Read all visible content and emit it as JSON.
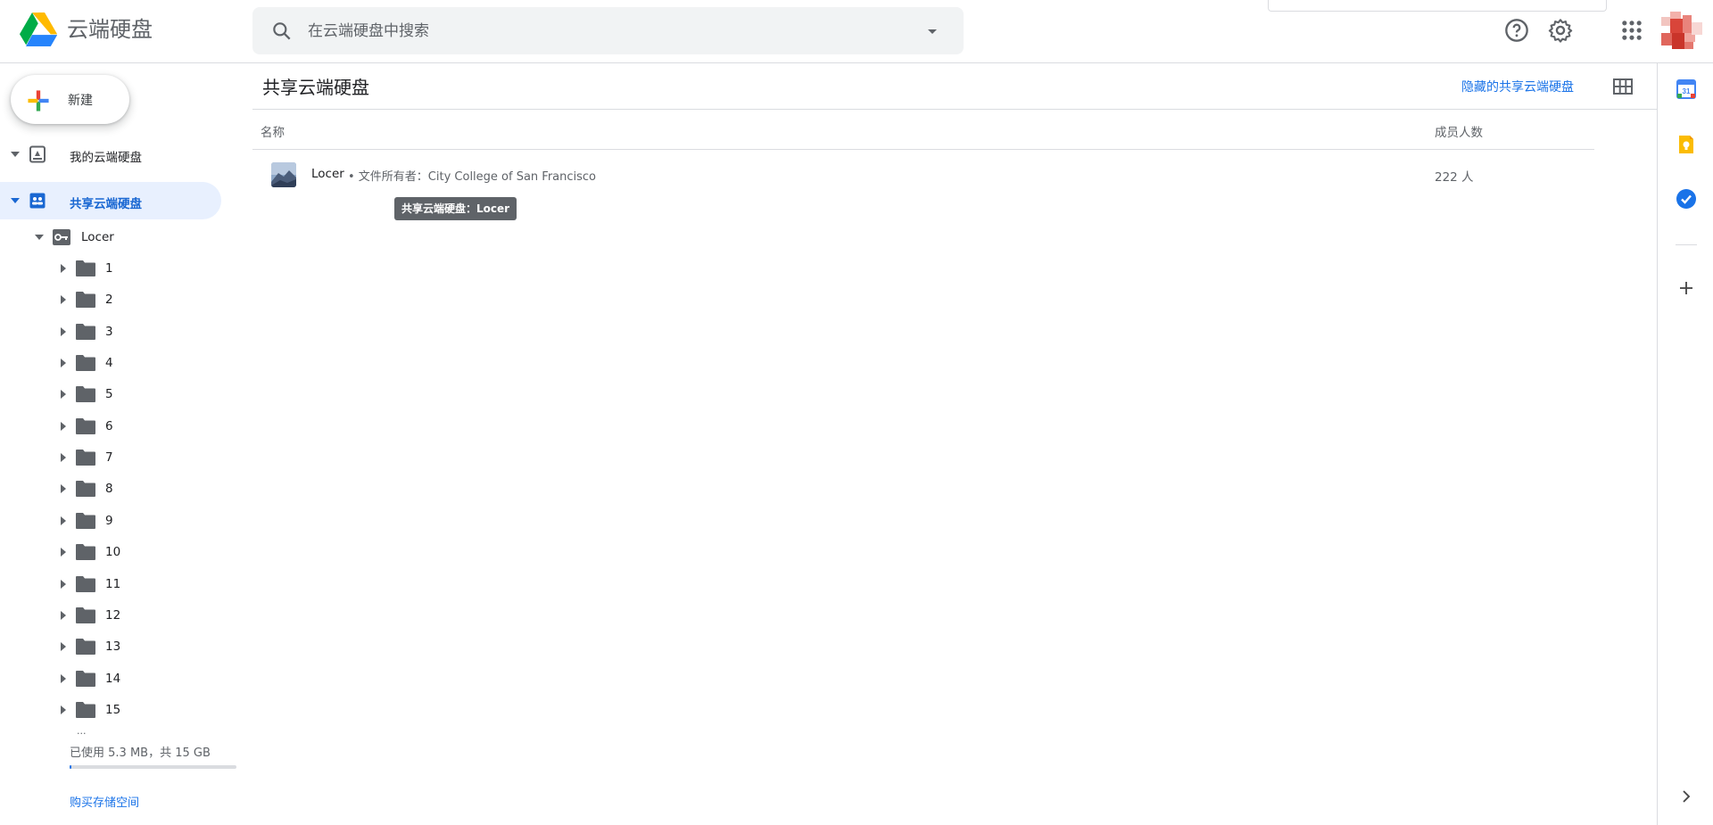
{
  "app": {
    "title": "云端硬盘"
  },
  "search": {
    "placeholder": "在云端硬盘中搜索"
  },
  "header_icons": [
    "help-icon",
    "settings-icon",
    "apps-grid-icon",
    "account-avatar"
  ],
  "sidebar": {
    "new_label": "新建",
    "nav": [
      {
        "label": "我的云端硬盘",
        "icon": "my-drive-icon",
        "expanded": true
      },
      {
        "label": "共享云端硬盘",
        "icon": "shared-drives-icon",
        "expanded": true,
        "active": true
      }
    ],
    "tree_root": {
      "label": "Locer",
      "icon": "shared-drive-icon",
      "expanded": true
    },
    "folders": [
      "1",
      "2",
      "3",
      "4",
      "5",
      "6",
      "7",
      "8",
      "9",
      "10",
      "11",
      "12",
      "13",
      "14",
      "15"
    ],
    "more_indicator": "...",
    "storage": {
      "text": "已使用 5.3 MB，共 15 GB",
      "used_fraction": 0.0004
    },
    "buy_storage": "购买存储空间"
  },
  "main": {
    "title": "共享云端硬盘",
    "hidden_drives_link": "隐藏的共享云端硬盘",
    "columns": {
      "name": "名称",
      "members": "成员人数"
    },
    "rows": [
      {
        "name": "Locer",
        "owner": "• 文件所有者：City College of San Francisco",
        "members": "222 人"
      }
    ],
    "tooltip": "共享云端硬盘：Locer"
  },
  "side_panel": [
    "calendar-icon",
    "keep-icon",
    "tasks-icon",
    "add-addon-icon",
    "expand-panel-icon"
  ],
  "colors": {
    "accent": "#1a73e8",
    "active_bg": "#e8f0fe",
    "folder": "#5f6368"
  }
}
